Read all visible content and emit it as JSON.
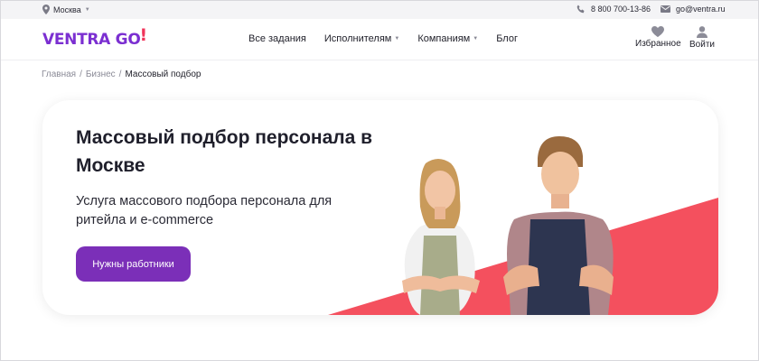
{
  "topbar": {
    "city": "Москва",
    "phone": "8 800 700-13-86",
    "email": "go@ventra.ru"
  },
  "header": {
    "logo_text": "VENTRA GO",
    "nav": [
      {
        "label": "Все задания",
        "has_dropdown": false
      },
      {
        "label": "Исполнителям",
        "has_dropdown": true
      },
      {
        "label": "Компаниям",
        "has_dropdown": true
      },
      {
        "label": "Блог",
        "has_dropdown": false
      }
    ],
    "favorites_label": "Избранное",
    "login_label": "Войти"
  },
  "breadcrumb": {
    "items": [
      "Главная",
      "Бизнес"
    ],
    "current": "Массовый подбор"
  },
  "hero": {
    "title": "Массовый подбор персонала в Москве",
    "subtitle": "Услуга массового подбора персонала для ритейла и e-commerce",
    "cta_label": "Нужны работники"
  },
  "colors": {
    "brand_purple": "#7b2fd1",
    "button_purple": "#7b2fb8",
    "accent_red": "#f4505e"
  },
  "icons": {
    "location": "map-pin-icon",
    "phone": "phone-icon",
    "mail": "mail-icon",
    "favorites": "heart-icon",
    "login": "user-icon"
  }
}
